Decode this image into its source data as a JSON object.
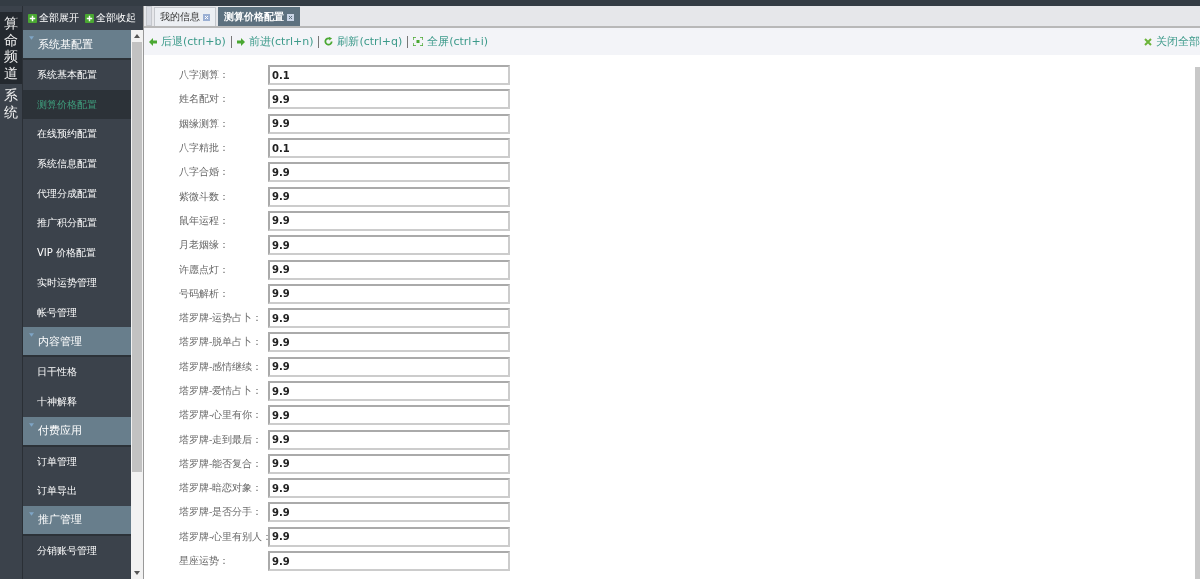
{
  "channels": [
    {
      "label": "算命频道",
      "selected": true
    },
    {
      "label": "系统",
      "selected": false
    }
  ],
  "sidebar": {
    "actions": [
      "全部展开",
      "全部收起"
    ],
    "groups": [
      {
        "title": "系统基配置",
        "expanded": true,
        "items": [
          {
            "label": "系统基本配置",
            "selected": false
          },
          {
            "label": "测算价格配置",
            "selected": true
          },
          {
            "label": "在线预约配置",
            "selected": false
          },
          {
            "label": "系统信息配置",
            "selected": false
          },
          {
            "label": "代理分成配置",
            "selected": false
          },
          {
            "label": "推广积分配置",
            "selected": false
          },
          {
            "label": "VIP 价格配置",
            "selected": false
          },
          {
            "label": "实时运势管理",
            "selected": false
          },
          {
            "label": "帐号管理",
            "selected": false
          }
        ]
      },
      {
        "title": "内容管理",
        "expanded": true,
        "items": [
          {
            "label": "日干性格",
            "selected": false
          },
          {
            "label": "十神解释",
            "selected": false
          }
        ]
      },
      {
        "title": "付费应用",
        "expanded": true,
        "items": [
          {
            "label": "订单管理",
            "selected": false
          },
          {
            "label": "订单导出",
            "selected": false
          }
        ]
      },
      {
        "title": "推广管理",
        "expanded": true,
        "items": [
          {
            "label": "分销账号管理",
            "selected": false
          }
        ]
      }
    ]
  },
  "tabs": [
    {
      "label": "我的信息",
      "selected": false
    },
    {
      "label": "测算价格配置",
      "selected": true
    }
  ],
  "toolbar": {
    "actions": [
      {
        "label": "后退(ctrl+b)",
        "kind": "back"
      },
      {
        "label": "前进(ctrl+n)",
        "kind": "forward"
      },
      {
        "label": "刷新(ctrl+q)",
        "kind": "refresh"
      },
      {
        "label": "全屏(ctrl+i)",
        "kind": "fullscreen"
      }
    ],
    "close_all": "关闭全部"
  },
  "form": {
    "fields": [
      {
        "label": "八字测算：",
        "value": "0.1"
      },
      {
        "label": "姓名配对：",
        "value": "9.9"
      },
      {
        "label": "姻缘测算：",
        "value": "9.9"
      },
      {
        "label": "八字精批：",
        "value": "0.1"
      },
      {
        "label": "八字合婚：",
        "value": "9.9"
      },
      {
        "label": "紫微斗数：",
        "value": "9.9"
      },
      {
        "label": "鼠年运程：",
        "value": "9.9"
      },
      {
        "label": "月老姻缘：",
        "value": "9.9"
      },
      {
        "label": "许愿点灯：",
        "value": "9.9"
      },
      {
        "label": "号码解析：",
        "value": "9.9"
      },
      {
        "label": "塔罗牌-运势占卜：",
        "value": "9.9"
      },
      {
        "label": "塔罗牌-脱单占卜：",
        "value": "9.9"
      },
      {
        "label": "塔罗牌-感情继续：",
        "value": "9.9"
      },
      {
        "label": "塔罗牌-爱情占卜：",
        "value": "9.9"
      },
      {
        "label": "塔罗牌-心里有你：",
        "value": "9.9"
      },
      {
        "label": "塔罗牌-走到最后：",
        "value": "9.9"
      },
      {
        "label": "塔罗牌-能否复合：",
        "value": "9.9"
      },
      {
        "label": "塔罗牌-暗恋对象：",
        "value": "9.9"
      },
      {
        "label": "塔罗牌-是否分手：",
        "value": "9.9"
      },
      {
        "label": "塔罗牌-心里有别人：",
        "value": "9.9"
      },
      {
        "label": "星座运势：",
        "value": "9.9"
      }
    ]
  }
}
